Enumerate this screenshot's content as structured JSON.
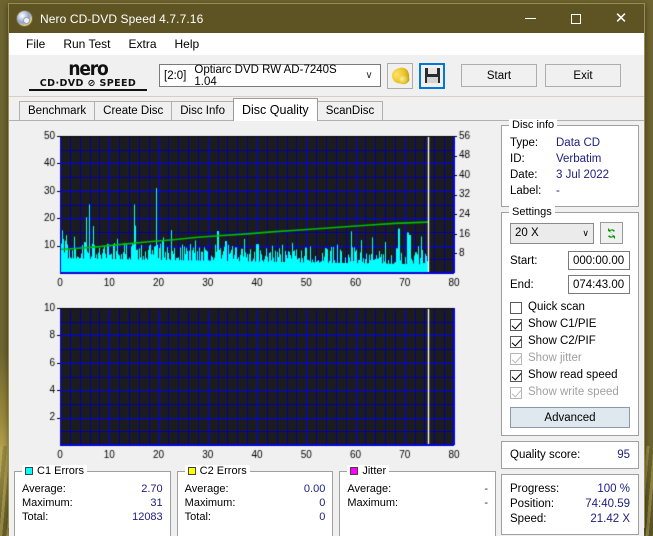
{
  "window": {
    "title": "Nero CD-DVD Speed 4.7.7.16",
    "icon": "nero-disc-icon",
    "minimize": "—",
    "maximize": "□",
    "close": "✕"
  },
  "menu": {
    "items": [
      {
        "label": "File"
      },
      {
        "label": "Run Test"
      },
      {
        "label": "Extra"
      },
      {
        "label": "Help"
      }
    ]
  },
  "toolbar": {
    "logo_word": "nero",
    "logo_sub": "CD·DVD ⊘ SPEED",
    "drive": "Optiarc DVD RW AD-7240S 1.04",
    "drive_bracket": "[2:0]",
    "drive_arrow": "∨",
    "eject_icon": "eject-disc-icon",
    "save_icon": "floppy-save-icon",
    "start_label": "Start",
    "exit_label": "Exit"
  },
  "tabs": {
    "items": [
      {
        "label": "Benchmark",
        "selected": false
      },
      {
        "label": "Create Disc",
        "selected": false
      },
      {
        "label": "Disc Info",
        "selected": false
      },
      {
        "label": "Disc Quality",
        "selected": true
      },
      {
        "label": "ScanDisc",
        "selected": false
      }
    ]
  },
  "disc_info": {
    "title": "Disc info",
    "rows": [
      {
        "key": "Type:",
        "value": "Data CD"
      },
      {
        "key": "ID:",
        "value": "Verbatim"
      },
      {
        "key": "Date:",
        "value": "3 Jul 2022"
      },
      {
        "key": "Label:",
        "value": "-"
      }
    ]
  },
  "settings": {
    "title": "Settings",
    "speed": "20 X",
    "speed_arrow": "∨",
    "refresh_icon": "refresh-icon",
    "start_label": "Start:",
    "start_value": "000:00.00",
    "end_label": "End:",
    "end_value": "074:43.00",
    "checkboxes": [
      {
        "label": "Quick scan",
        "checked": false,
        "disabled": false
      },
      {
        "label": "Show C1/PIE",
        "checked": true,
        "disabled": false
      },
      {
        "label": "Show C2/PIF",
        "checked": true,
        "disabled": false
      },
      {
        "label": "Show jitter",
        "checked": true,
        "disabled": true
      },
      {
        "label": "Show read speed",
        "checked": true,
        "disabled": false
      },
      {
        "label": "Show write speed",
        "checked": true,
        "disabled": true
      }
    ],
    "advanced_label": "Advanced"
  },
  "quality": {
    "label": "Quality score:",
    "value": "95"
  },
  "progress": {
    "rows": [
      {
        "key": "Progress:",
        "value": "100 %"
      },
      {
        "key": "Position:",
        "value": "74:40.59"
      },
      {
        "key": "Speed:",
        "value": "21.42 X"
      }
    ]
  },
  "stats": {
    "groups": [
      {
        "title": "C1 Errors",
        "swatch": "#00ffff",
        "rows": [
          {
            "key": "Average:",
            "value": "2.70"
          },
          {
            "key": "Maximum:",
            "value": "31"
          },
          {
            "key": "Total:",
            "value": "12083"
          }
        ]
      },
      {
        "title": "C2 Errors",
        "swatch": "#ffff00",
        "rows": [
          {
            "key": "Average:",
            "value": "0.00"
          },
          {
            "key": "Maximum:",
            "value": "0"
          },
          {
            "key": "Total:",
            "value": "0"
          }
        ]
      },
      {
        "title": "Jitter",
        "swatch": "#ff00ff",
        "rows": [
          {
            "key": "Average:",
            "value": "-"
          },
          {
            "key": "Maximum:",
            "value": "-"
          }
        ]
      }
    ]
  },
  "chart_data": [
    {
      "type": "area",
      "name": "c1-errors-chart",
      "title": "C1 Errors / read speed vs disc position",
      "xlabel": "",
      "ylabel": "",
      "xlim": [
        0,
        80
      ],
      "ylim": [
        0,
        50
      ],
      "y2lim": [
        0,
        56
      ],
      "xticks": [
        0,
        10,
        20,
        30,
        40,
        50,
        60,
        70,
        80
      ],
      "yticks": [
        10,
        20,
        30,
        40,
        50
      ],
      "y2ticks": [
        8,
        16,
        24,
        32,
        40,
        48,
        56
      ],
      "grid": true,
      "grid_color": "#0000c8",
      "bg_color": "#1c1c1c",
      "scan_end_x": 74.7,
      "cursor_color": "#ffffff",
      "series": [
        {
          "name": "C1 Errors",
          "color": "#00ffff",
          "render": "spikes",
          "x_end": 74.7,
          "baseline_start": 12.0,
          "baseline_end": 7.0,
          "values": [
            20,
            13,
            16,
            9,
            25,
            15,
            11,
            14,
            20,
            31,
            25,
            22,
            24,
            10,
            20,
            16,
            8,
            6,
            30,
            23,
            12,
            14,
            18,
            11,
            10,
            19,
            8,
            25,
            13,
            9,
            16,
            12,
            7,
            10,
            14,
            31,
            12,
            9,
            13,
            8,
            12,
            22,
            10,
            9,
            8,
            36,
            22,
            8,
            11,
            6,
            14,
            9,
            13,
            17,
            10,
            7,
            12,
            11,
            22,
            9,
            8,
            14,
            11,
            7,
            10,
            9,
            12,
            8,
            16,
            9,
            7,
            11,
            8,
            12,
            7,
            10,
            9,
            13,
            8,
            11,
            7,
            9,
            12,
            7,
            10,
            8,
            11,
            6,
            9,
            12,
            8,
            10,
            7,
            11,
            9,
            8,
            12,
            6,
            10,
            9,
            7,
            11,
            8,
            13,
            9,
            7,
            10,
            8,
            24,
            11,
            9,
            7,
            12,
            8,
            10,
            9,
            13,
            7,
            11,
            8,
            10,
            16,
            9,
            12,
            7,
            11,
            27,
            9,
            14,
            24,
            22,
            11,
            8,
            13,
            21,
            10,
            7,
            19
          ]
        },
        {
          "name": "Read speed",
          "color": "#00c000",
          "render": "line",
          "axis": "right",
          "x": [
            0,
            3,
            8,
            13,
            18,
            23,
            28,
            33,
            38,
            43,
            48,
            53,
            58,
            63,
            68,
            72,
            74.7
          ],
          "values": [
            9.6,
            10.0,
            10.8,
            11.8,
            12.8,
            13.6,
            14.6,
            15.3,
            16.0,
            16.8,
            17.5,
            18.2,
            18.9,
            19.6,
            20.3,
            20.6,
            20.8
          ]
        }
      ]
    },
    {
      "type": "area",
      "name": "c2-errors-chart",
      "title": "C2 Errors vs disc position",
      "xlabel": "",
      "ylabel": "",
      "xlim": [
        0,
        80
      ],
      "ylim": [
        0,
        10
      ],
      "xticks": [
        0,
        10,
        20,
        30,
        40,
        50,
        60,
        70,
        80
      ],
      "yticks": [
        2,
        4,
        6,
        8,
        10
      ],
      "grid": true,
      "grid_color": "#0000c8",
      "bg_color": "#1c1c1c",
      "scan_end_x": 74.7,
      "cursor_color": "#ffffff",
      "series": [
        {
          "name": "C2 Errors",
          "color": "#ffff00",
          "render": "spikes",
          "values": []
        }
      ]
    }
  ]
}
